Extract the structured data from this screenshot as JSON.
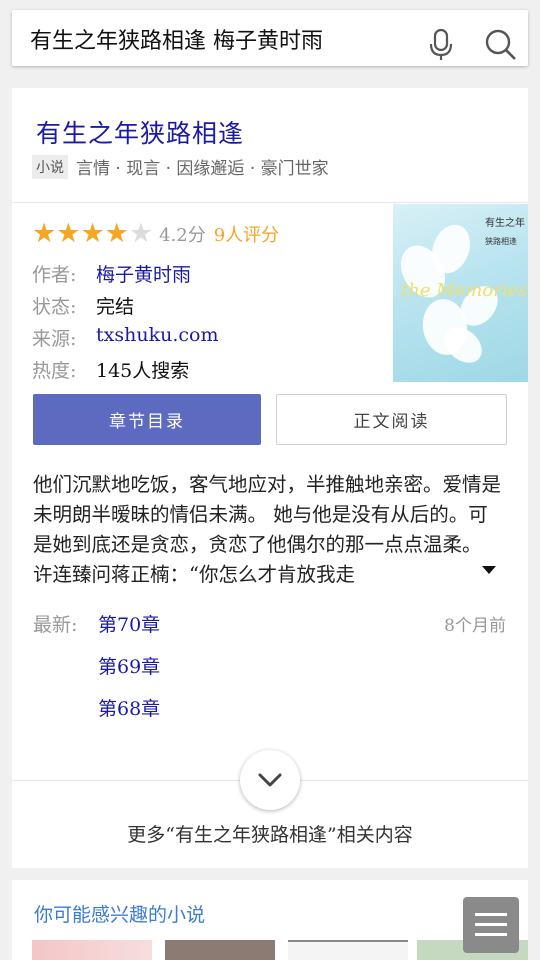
{
  "search": {
    "query": "有生之年狭路相逢 梅子黄时雨"
  },
  "book": {
    "title": "有生之年狭路相逢",
    "category_badge": "小说",
    "tags": "言情 · 现言 · 因缘邂逅 · 豪门世家",
    "rating": {
      "score_text": "4.2分",
      "raters_text": "9人评分",
      "stars": 4.2,
      "star_icon_filled": "star-icon",
      "star_color": "#f5a623"
    },
    "info": [
      {
        "key": "作者:",
        "value": "梅子黄时雨"
      },
      {
        "key": "状态:",
        "value": "完结"
      },
      {
        "key": "来源:",
        "value": "txshuku.com"
      },
      {
        "key": "热度:",
        "value": "145人搜索"
      }
    ],
    "cover": {
      "title_line": "有生之年",
      "sub_line": "狭路相逢",
      "art_text": "the Memories"
    },
    "buttons": {
      "toc": "章节目录",
      "read": "正文阅读"
    },
    "description": "他们沉默地吃饭，客气地应对，半推触地亲密。爱情是未明朗半暧昧的情侣未满。 她与他是没有从后的。可是她到底还是贪恋，贪恋了他偶尔的那一点点温柔。 许连臻问蒋正楠：“你怎么才肯放我走",
    "latest": {
      "label": "最新:",
      "time": "8个月前",
      "chapters": [
        "第70章",
        "第69章",
        "第68章"
      ]
    },
    "more_related": "更多“有生之年狭路相逢”相关内容",
    "accent_color": "#5c6bc0"
  },
  "recommend": {
    "title": "你可能感兴趣的小说"
  }
}
